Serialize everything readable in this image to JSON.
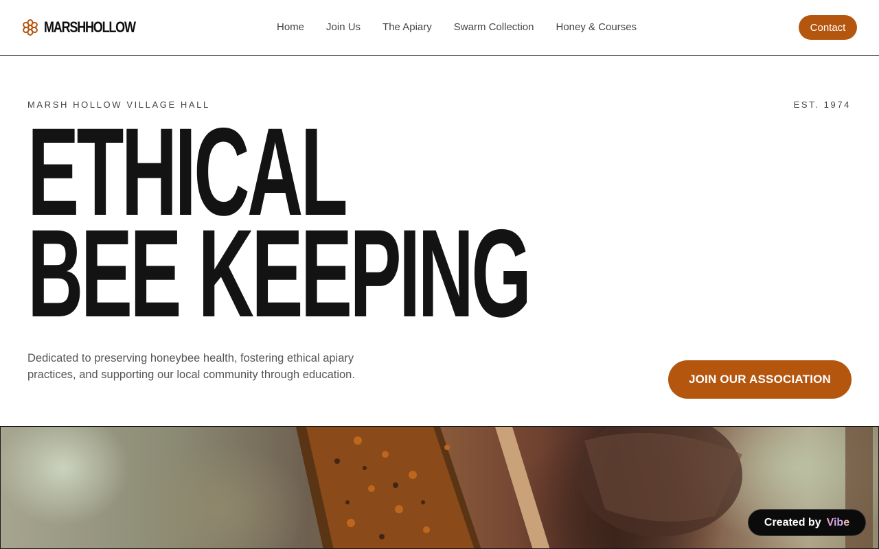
{
  "header": {
    "logo_text": "MARSHHOLLOW",
    "logo_icon": "flower-icon",
    "nav": [
      {
        "label": "Home"
      },
      {
        "label": "Join Us"
      },
      {
        "label": "The Apiary"
      },
      {
        "label": "Swarm Collection"
      },
      {
        "label": "Honey & Courses"
      }
    ],
    "contact_label": "Contact"
  },
  "hero": {
    "eyebrow_left": "MARSH HOLLOW VILLAGE HALL",
    "eyebrow_right": "EST. 1974",
    "headline_line1": "ETHICAL",
    "headline_line2": "BEE KEEPING",
    "description": "Dedicated to preserving honeybee health, fostering ethical apiary practices, and supporting our local community through education.",
    "cta_label": "JOIN OUR ASSOCIATION",
    "image_description_icon": "beekeeper-photo"
  },
  "badge": {
    "prefix": "Created by",
    "brand": "Vibe"
  },
  "colors": {
    "accent": "#b5560f",
    "text_dark": "#131313",
    "text_muted": "#555555",
    "background": "#ffffff"
  }
}
